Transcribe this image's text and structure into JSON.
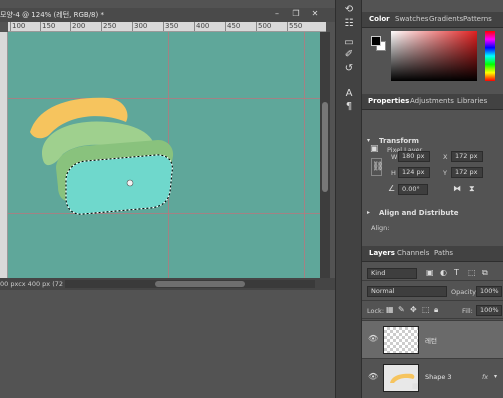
{
  "document": {
    "tab_title": "모양-4 @ 124% (레턴, RGB/8) *",
    "ruler_labels": [
      "100",
      "150",
      "200",
      "250",
      "300",
      "350",
      "400",
      "450",
      "500",
      "550"
    ],
    "status_text": "00 pxcx 400 px (72 ppi)"
  },
  "color_panel": {
    "tabs": [
      "Color",
      "Swatches",
      "Gradients",
      "Patterns"
    ],
    "foreground_color": "#000000",
    "background_color": "#ffffff"
  },
  "properties_panel": {
    "tabs": [
      "Properties",
      "Adjustments",
      "Libraries"
    ],
    "layer_type": "Pixel Layer",
    "transform_title": "Transform",
    "w_label": "W",
    "w_value": "180 px",
    "h_label": "H",
    "h_value": "124 px",
    "x_label": "X",
    "x_value": "172 px",
    "y_label": "Y",
    "y_value": "172 px",
    "angle_value": "0.00°",
    "align_title": "Align and Distribute",
    "align_label": "Align:"
  },
  "layers_panel": {
    "tabs": [
      "Layers",
      "Channels",
      "Paths"
    ],
    "kind_filter": "Kind",
    "blend_mode": "Normal",
    "opacity_label": "Opacity:",
    "opacity_value": "100%",
    "lock_label": "Lock:",
    "fill_label": "Fill:",
    "fill_value": "100%",
    "layers": [
      {
        "name": "레턴",
        "selected": true
      },
      {
        "name": "Shape 3",
        "selected": false,
        "fx": "fx"
      }
    ]
  },
  "colors": {
    "canvas_bg": "#5fa79a",
    "shape_yellow": "#f6c45e",
    "shape_green": "#9fd08e",
    "shape_cyan": "#6fd8cc",
    "guide": "#c0727a"
  }
}
